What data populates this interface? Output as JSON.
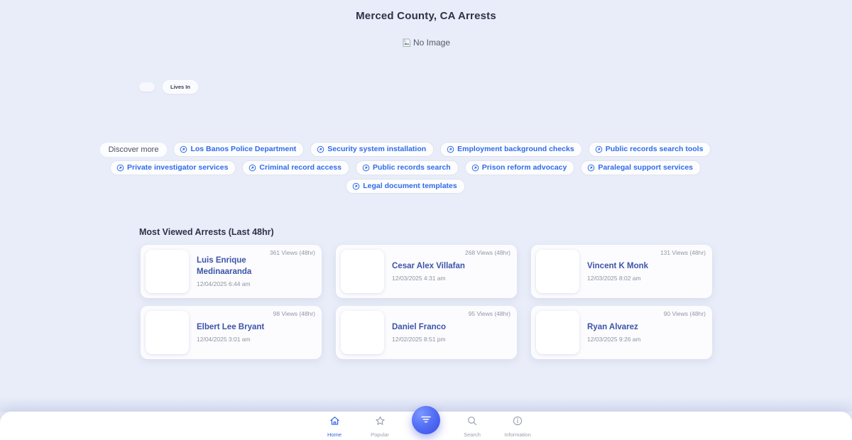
{
  "page": {
    "title": "Merced County, CA Arrests",
    "no_image_alt": "No Image"
  },
  "profile": {
    "lives_in_label": "Lives In"
  },
  "discover": {
    "label": "Discover more",
    "chips": [
      "Los Banos Police Department",
      "Security system installation",
      "Employment background checks",
      "Public records search tools",
      "Private investigator services",
      "Criminal record access",
      "Public records search",
      "Prison reform advocacy",
      "Paralegal support services",
      "Legal document templates"
    ]
  },
  "most_viewed": {
    "title": "Most Viewed Arrests (Last 48hr)",
    "cards": [
      {
        "name": "Luis Enrique Medinaaranda",
        "date": "12/04/2025 6:44 am",
        "views": "361 Views (48hr)"
      },
      {
        "name": "Cesar Alex Villafan",
        "date": "12/03/2025 4:31 am",
        "views": "268 Views (48hr)"
      },
      {
        "name": "Vincent K Monk",
        "date": "12/03/2025 8:02 am",
        "views": "131 Views (48hr)"
      },
      {
        "name": "Elbert Lee Bryant",
        "date": "12/04/2025 3:01 am",
        "views": "98 Views (48hr)"
      },
      {
        "name": "Daniel Franco",
        "date": "12/02/2025 8:51 pm",
        "views": "95 Views (48hr)"
      },
      {
        "name": "Ryan Alvarez",
        "date": "12/03/2025 9:26 am",
        "views": "90 Views (48hr)"
      }
    ]
  },
  "bottom_nav": {
    "items": [
      {
        "label": "Home",
        "icon": "home-icon",
        "active": true
      },
      {
        "label": "Popular",
        "icon": "star-icon",
        "active": false
      },
      {
        "label": "Search",
        "icon": "search-icon",
        "active": false
      },
      {
        "label": "Information",
        "icon": "info-icon",
        "active": false
      }
    ],
    "fab_icon": "filter-icon"
  },
  "colors": {
    "background": "#e9edf9",
    "chip_text": "#2e6bea",
    "name_link": "#3c53a9",
    "accent_blue": "#3164e8",
    "fab_gradient_start": "#7d97ff",
    "fab_gradient_end": "#3a4ce6"
  }
}
